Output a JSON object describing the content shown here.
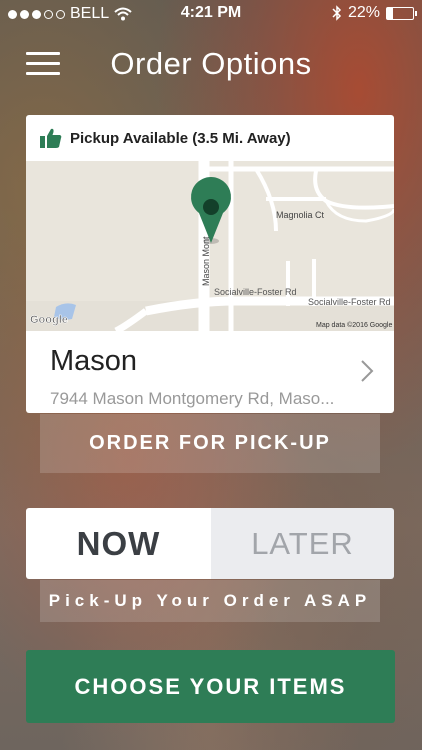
{
  "status_bar": {
    "carrier": "BELL",
    "time": "4:21 PM",
    "battery_percent": "22%",
    "battery_level": 0.22,
    "signal_bars": 3,
    "signal_total": 5
  },
  "nav": {
    "title": "Order Options",
    "menu_icon": "hamburger-menu-icon"
  },
  "pickup": {
    "text": "Pickup Available (3.5 Mi. Away)",
    "icon": "thumbs-up-icon",
    "icon_color": "#2e7d56"
  },
  "map": {
    "streets": [
      "Magnolia Ct",
      "Mason Mont",
      "Socialville-Foster Rd",
      "Socialville-Foster Rd"
    ],
    "google_label": "Google",
    "attribution": "Map data ©2016 Google",
    "pin_icon": "map-pin-icon",
    "pin_color": "#2e7d56"
  },
  "store": {
    "name": "Mason",
    "address": "7944 Mason Montgomery Rd, Maso...",
    "chevron_icon": "chevron-right-icon"
  },
  "order_pickup_button": "ORDER FOR PICK-UP",
  "time_toggle": {
    "now": "NOW",
    "later": "LATER",
    "selected": "NOW"
  },
  "asap_text": "Pick-Up Your Order ASAP",
  "choose_items_button": "CHOOSE YOUR ITEMS",
  "colors": {
    "accent": "#2e7d56"
  }
}
